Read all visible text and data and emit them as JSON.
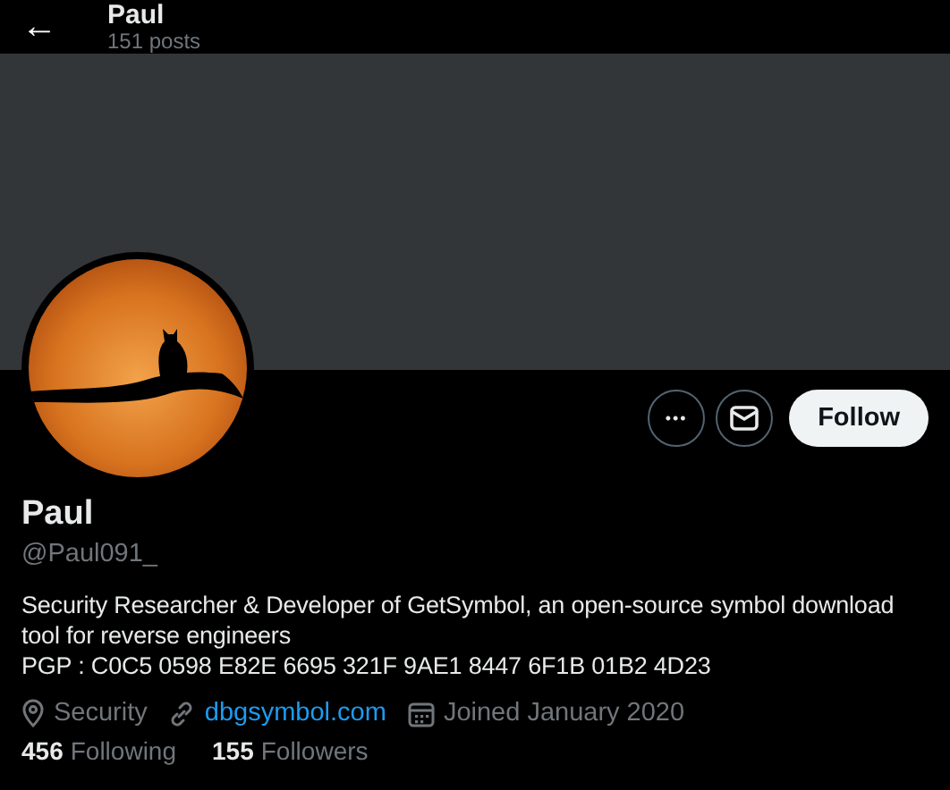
{
  "header": {
    "back_icon": "←",
    "title": "Paul",
    "subtitle": "151 posts"
  },
  "actions": [
    {
      "kind": "more",
      "label": "•••"
    },
    {
      "kind": "message"
    },
    {
      "kind": "follow",
      "label": "Follow"
    }
  ],
  "profile": {
    "name": "Paul",
    "handle": "@Paul091_",
    "bio": [
      "Security Researcher & Developer of GetSymbol, an open-source symbol download tool for reverse engineers",
      "PGP : C0C5 0598 E82E 6695 321F 9AE1 8447 6F1B 01B2 4D23"
    ],
    "meta": [
      {
        "kind": "location",
        "text": "Security"
      },
      {
        "kind": "link",
        "text": "dbgsymbol.com"
      },
      {
        "kind": "joined",
        "text": "Joined January 2020"
      }
    ],
    "stats": [
      {
        "count": "456",
        "label": "Following"
      },
      {
        "count": "155",
        "label": "Followers"
      }
    ]
  }
}
